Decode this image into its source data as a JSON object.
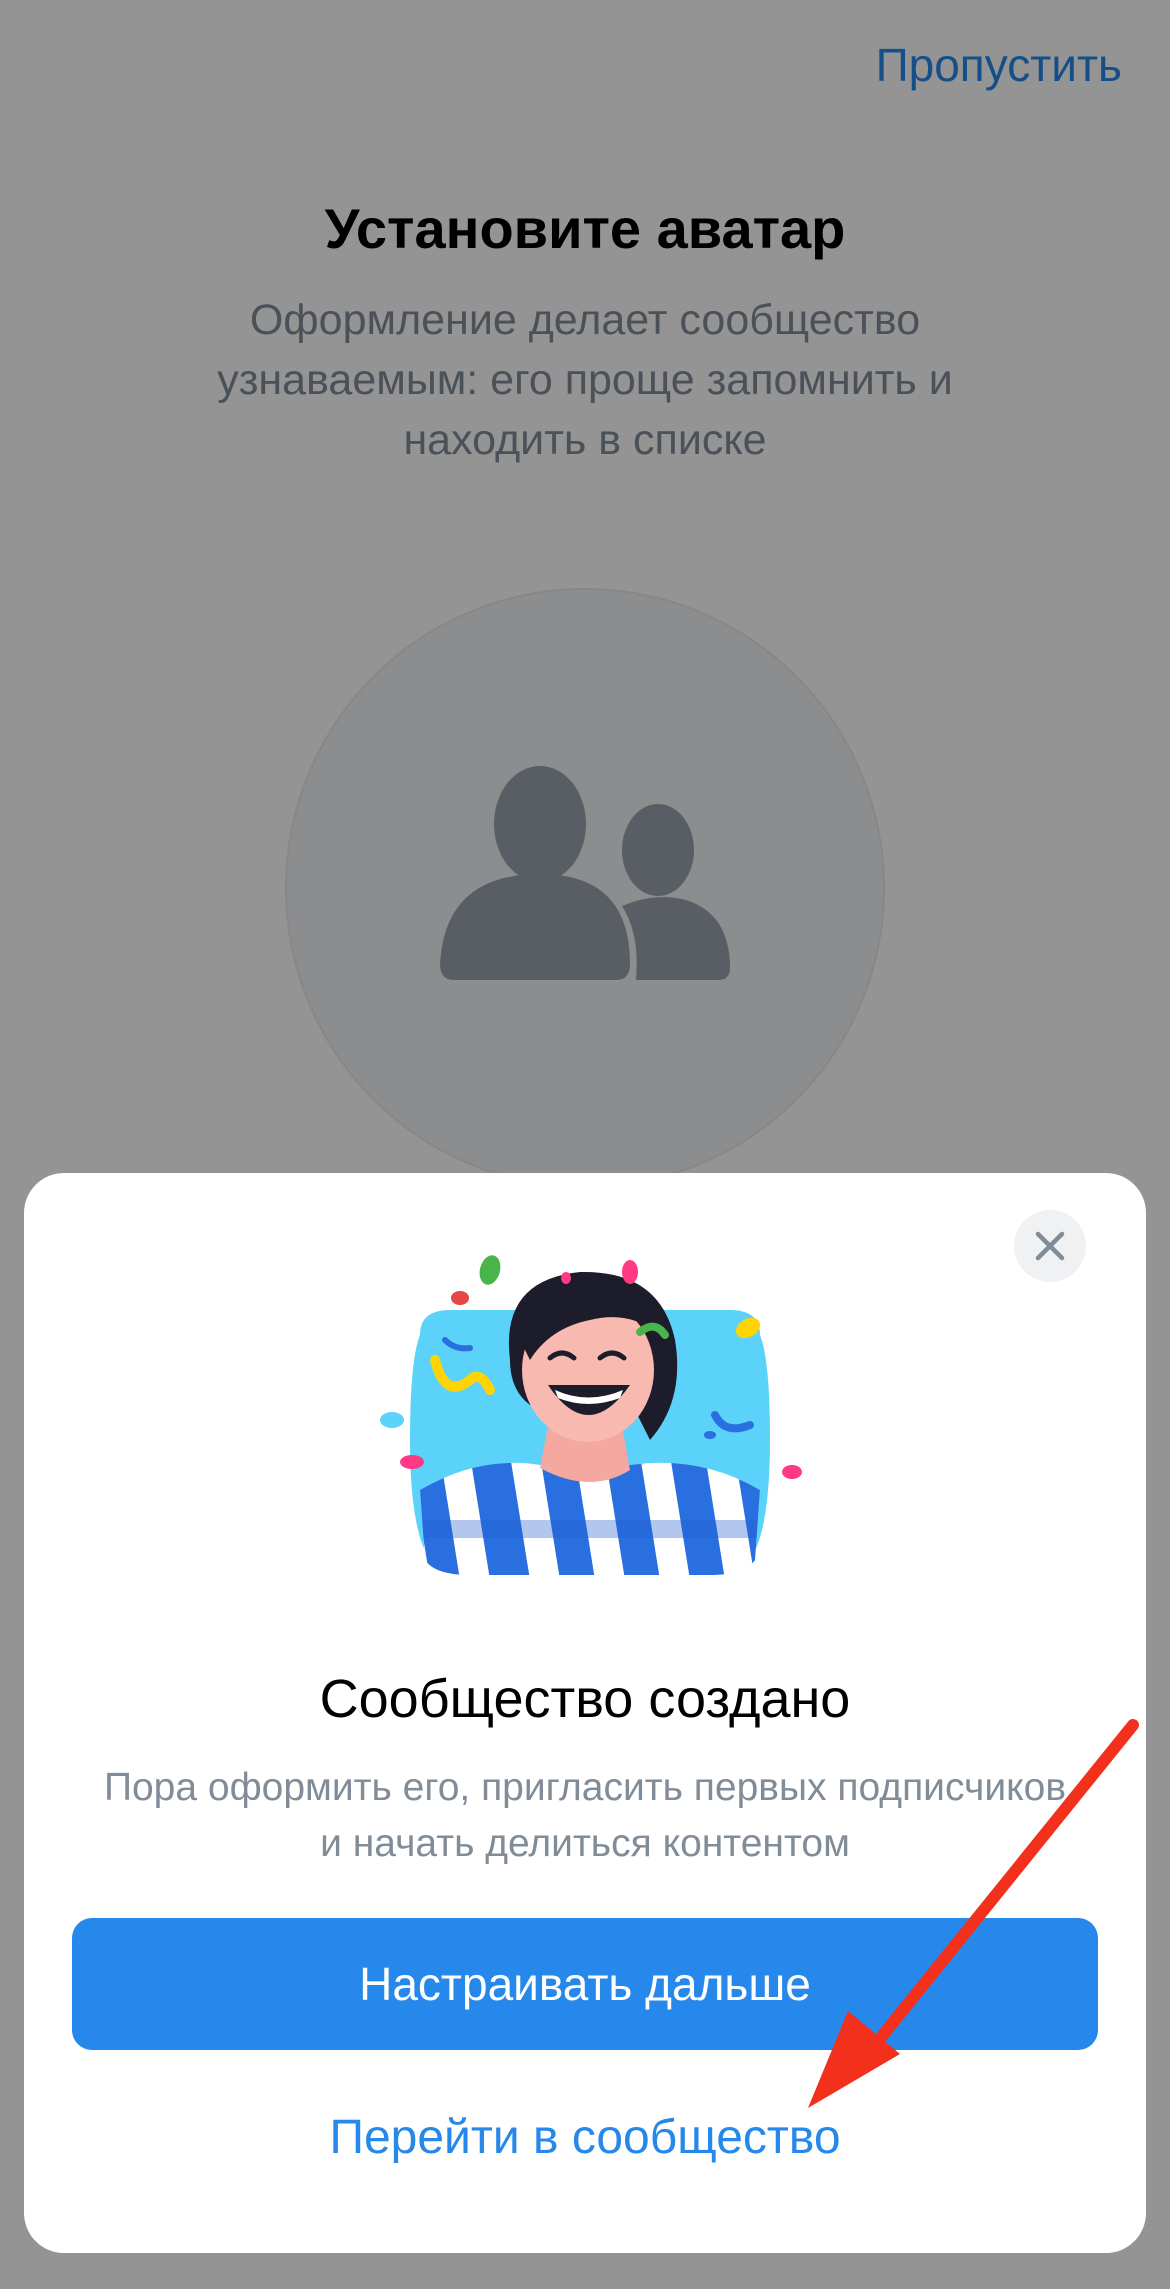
{
  "screen": {
    "skip_label": "Пропустить",
    "title": "Установите аватар",
    "description": "Оформление делает сообщество узнаваемым: его проще запомнить и находить в списке"
  },
  "modal": {
    "title": "Сообщество создано",
    "description": "Пора оформить его, пригласить первых подписчиков и начать делиться контентом",
    "primary_button": "Настраивать дальше",
    "secondary_link": "Перейти в сообщество"
  },
  "colors": {
    "accent": "#2688eb",
    "annotation_arrow": "#f2301b"
  },
  "icons": [
    "community-avatar-icon",
    "close-icon",
    "annotation-arrow-icon"
  ]
}
